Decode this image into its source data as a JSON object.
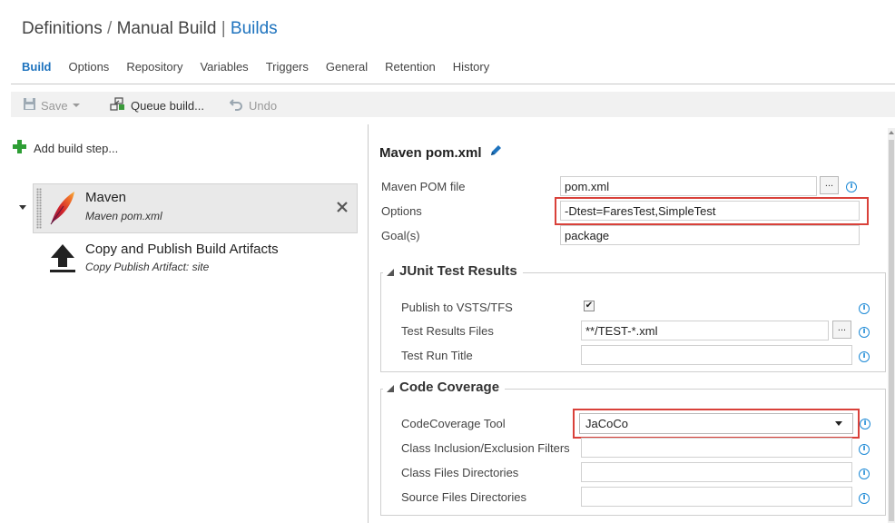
{
  "header": {
    "breadcrumb_root": "Definitions",
    "breadcrumb_sep1": "/",
    "breadcrumb_mid": "Manual Build",
    "breadcrumb_sep2": "|",
    "breadcrumb_current": "Builds"
  },
  "tabs": [
    {
      "label": "Build",
      "active": true
    },
    {
      "label": "Options"
    },
    {
      "label": "Repository"
    },
    {
      "label": "Variables"
    },
    {
      "label": "Triggers"
    },
    {
      "label": "General"
    },
    {
      "label": "Retention"
    },
    {
      "label": "History"
    }
  ],
  "toolbar": {
    "save_label": "Save",
    "queue_label": "Queue build...",
    "undo_label": "Undo"
  },
  "steps_panel": {
    "add_step_label": "Add build step...",
    "steps": [
      {
        "title": "Maven",
        "subtitle": "Maven pom.xml",
        "icon": "maven-feather-icon",
        "selected": true
      },
      {
        "title": "Copy and Publish Build Artifacts",
        "subtitle": "Copy Publish Artifact: site",
        "icon": "upload-arrow-icon"
      }
    ]
  },
  "detail": {
    "title": "Maven pom.xml",
    "fields": {
      "pom_label": "Maven POM file",
      "pom_value": "pom.xml",
      "options_label": "Options",
      "options_value": "-Dtest=FaresTest,SimpleTest",
      "goals_label": "Goal(s)",
      "goals_value": "package",
      "browse_label": "..."
    },
    "junit": {
      "title": "JUnit Test Results",
      "publish_label": "Publish to VSTS/TFS",
      "publish_checked": true,
      "results_files_label": "Test Results Files",
      "results_files_value": "**/TEST-*.xml",
      "run_title_label": "Test Run Title",
      "run_title_value": ""
    },
    "coverage": {
      "title": "Code Coverage",
      "tool_label": "CodeCoverage Tool",
      "tool_value": "JaCoCo",
      "class_filters_label": "Class Inclusion/Exclusion Filters",
      "class_files_label": "Class Files Directories",
      "source_files_label": "Source Files Directories"
    }
  },
  "colors": {
    "accent": "#1e73be",
    "highlight": "#d9413a",
    "info": "#1e8ad6",
    "add_green": "#2e9e35"
  }
}
